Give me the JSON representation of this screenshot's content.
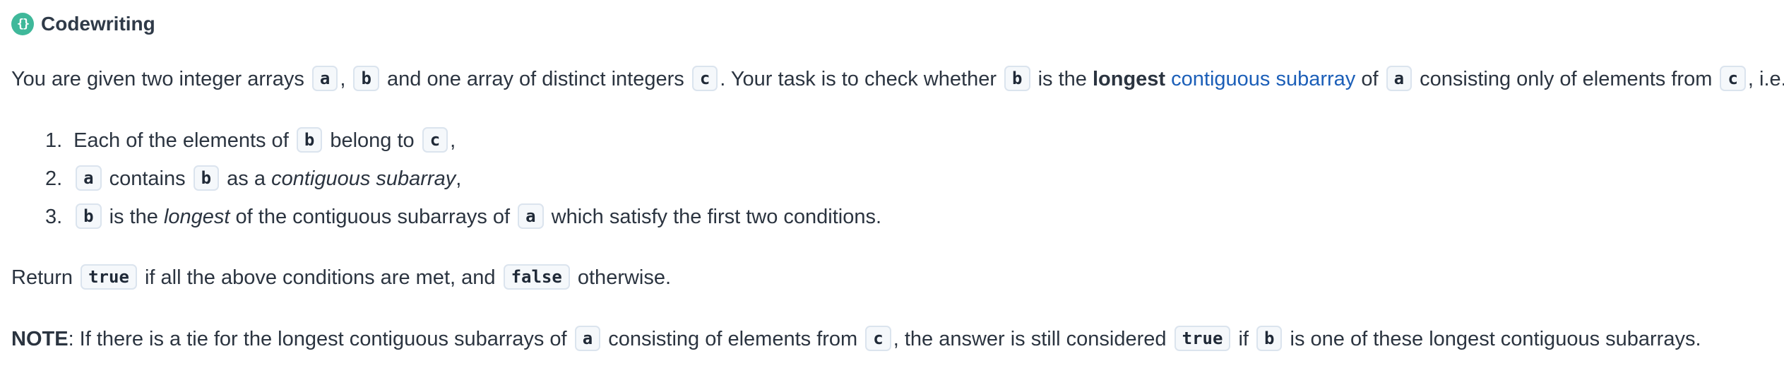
{
  "header": {
    "logo_glyph": "{}",
    "title": "Codewriting"
  },
  "description": {
    "p1_1": "You are given two integer arrays",
    "code_a": "a",
    "p1_2": ",",
    "code_b": "b",
    "p1_3": "and one array of distinct integers",
    "code_c": "c",
    "p1_4": ". Your task is to check whether",
    "p1_5": "is the",
    "bold_longest": "longest",
    "link_text": "contiguous subarray",
    "p1_6": "of",
    "p1_7": "consisting only of elements from",
    "p1_8": ", i.e."
  },
  "conditions": [
    {
      "number": "1.",
      "t1": "Each of the elements of",
      "code1": "b",
      "t2": "belong to",
      "code2": "c",
      "t3": ","
    },
    {
      "number": "2.",
      "code1": "a",
      "t1": "contains",
      "code2": "b",
      "t2": "as a",
      "em": "contiguous subarray",
      "t3": ","
    },
    {
      "number": "3.",
      "code1": "b",
      "t1": "is the",
      "em": "longest",
      "t2": "of the contiguous subarrays of",
      "code2": "a",
      "t3": "which satisfy the first two conditions."
    }
  ],
  "return_line": {
    "t1": "Return",
    "code_true": "true",
    "t2": "if all the above conditions are met, and",
    "code_false": "false",
    "t3": "otherwise."
  },
  "note": {
    "label": "NOTE",
    "t1": ": If there is a tie for the longest contiguous subarrays of",
    "code_a": "a",
    "t2": "consisting of elements from",
    "code_c": "c",
    "t3": ", the answer is still considered",
    "code_true": "true",
    "t4": "if",
    "code_b": "b",
    "t5": "is one of these longest contiguous subarrays."
  },
  "colors": {
    "logo": "#3fb89a",
    "link": "#1c5fb8",
    "text": "#2b3440"
  }
}
